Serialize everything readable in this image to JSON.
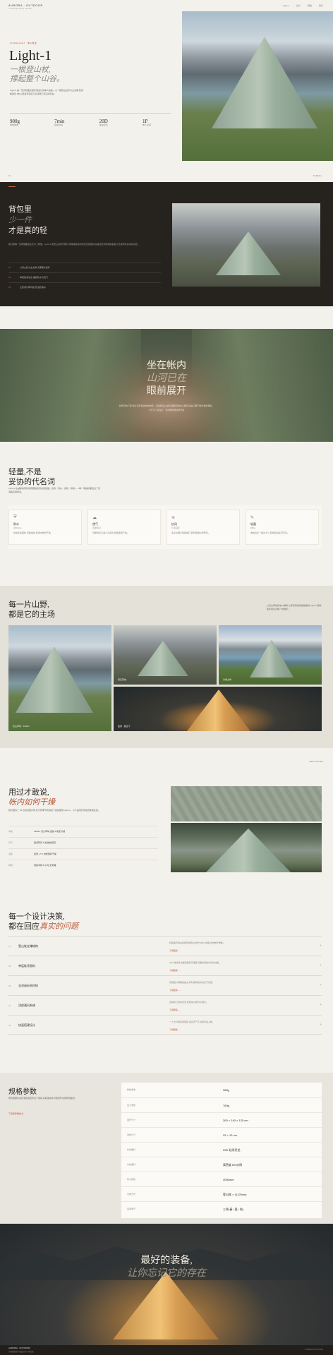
{
  "nav": {
    "logo": "AURORA · OUTDOOR",
    "logo_sub": "LIGHTWEIGHT GEAR",
    "links": [
      "Light-1",
      "设计",
      "规格",
      "联系"
    ]
  },
  "hero": {
    "kicker": "ULTRALIGHT · 单人帐篷",
    "title": "Light-1",
    "sub1": "一根登山杖,",
    "sub2": "撑起整个山谷。",
    "desc": "Light-1 是一顶为轻量化徒步者设计的单人帐篷。以一根登山杖作为主支撑,整顶帐篷仅 980g,装进背包后几乎感觉不到它的存在。",
    "stats": [
      {
        "num": "980g",
        "label": "整帐重量"
      },
      {
        "num": "7min",
        "label": "搭建时间"
      },
      {
        "num": "20D",
        "label": "硅涂尼龙"
      },
      {
        "num": "1P",
        "label": "单人空间"
      }
    ],
    "foot_left": "01",
    "foot_right": "SCROLL ↓"
  },
  "dark": {
    "line1": "背包里",
    "line2": "少一件",
    "line3": "才是真的轻",
    "desc": "我们把每一克重量都放在天平上称量。Light-1 用登山杖替代帐杆,用单层硅涂布替代双层结构,在保证防风防雨的前提下去掉所有多余的东西。",
    "features": [
      {
        "num": "01",
        "text": "以登山杖为主支撑,无需额外帐杆"
      },
      {
        "num": "02",
        "text": "单层硅涂尼龙,兼顾防水与透气"
      },
      {
        "num": "03",
        "text": "全封闭纱网内帐,防虫防露水"
      }
    ]
  },
  "banner": {
    "line1": "坐在帐内",
    "line2": "山河已在",
    "line3": "眼前展开",
    "desc": "拉开双向门帘,整片风景就是你的前院。清晨醒来,山峰与湖面同时映入眼帘,这是只属于徒步者的奢侈。",
    "desc2": "大开口门帘设计 · 支持单侧或双侧开启"
  },
  "weight": {
    "title1": "轻量,不是",
    "title2": "妥协的代名词",
    "desc": "Light-1 在减重的同时没有牺牲任何关键性能。抗风、防水、通风、耐用——每一项指标都经过了高海拔实地测试。",
    "cards": [
      {
        "icon": "shield-icon",
        "glyph": "⛨",
        "title": "防水",
        "sub": "3000mm",
        "desc": "硅涂尼龙面料,压胶缝线,暴雨中依然干爽。"
      },
      {
        "icon": "cloud-icon",
        "glyph": "☁",
        "title": "透气",
        "sub": "双通风口",
        "desc": "顶部通风口减少冷凝水,整夜保持干燥。"
      },
      {
        "icon": "wind-icon",
        "glyph": "≋",
        "title": "抗风",
        "sub": "8 点固定",
        "desc": "多点拉绳与加强地钉,稳稳抵御山脊阵风。"
      },
      {
        "icon": "feather-icon",
        "glyph": "✎",
        "title": "轻量",
        "sub": "980g",
        "desc": "收纳后仅一瓶水大小,轻松装进任何背包。"
      }
    ]
  },
  "gallery": {
    "title1": "每一片山野,",
    "title2": "都是它的主场",
    "desc": "从高山草甸到冰川湖畔,从碎石营地到夜色森林,Light-1 陪伴徒步者走过每一种地形。",
    "captions": [
      "高山草甸 · 3200m",
      "碎石营地",
      "冰湖之畔",
      "夜营 · 星空下"
    ]
  },
  "story": {
    "label": "FIELD NOTES",
    "title1": "用过才敢说,",
    "title2": "帐内如何干燥",
    "desc": "我们邀请了 30 位资深徒步者,在不同季节和海拔下连续使用 Light-1。以下是他们真实的使用反馈。",
    "rows": [
      {
        "k": "海拔",
        "v": "3200m 高山草甸,连续 5 晚无冷凝"
      },
      {
        "k": "天气",
        "v": "夜间阵风 6 级,帐体稳定"
      },
      {
        "k": "温度",
        "v": "最低 -2°C,内帐保持干燥"
      },
      {
        "k": "降雨",
        "v": "持续中雨 8 小时,无渗漏"
      }
    ]
  },
  "design": {
    "title1": "每一个设计决策,",
    "title2": "都在回应",
    "title3": "真实的问题",
    "rows": [
      {
        "num": "01",
        "title": "登山杖支撑结构",
        "desc": "利用徒步者本就携带的登山杖作为中心支撑,省去帐杆重量。",
        "link": "了解更多 →"
      },
      {
        "num": "02",
        "title": "单层硅涂面料",
        "desc": "20D 硅涂尼龙兼顾强度与轻量,双面涂层提升防水性能。",
        "link": "了解更多 →"
      },
      {
        "num": "03",
        "title": "全封闭纱网内帐",
        "desc": "高密度纱网隔绝蚊虫,同时保持良好的空气流通。",
        "link": "了解更多 →"
      },
      {
        "num": "04",
        "title": "顶部通风系统",
        "desc": "双通风口形成对流,有效减少帐内冷凝水。",
        "link": "了解更多 →"
      },
      {
        "num": "05",
        "title": "快速搭建设计",
        "desc": "一人七分钟完成搭建,恶劣天气下也能迅速入帐。",
        "link": "了解更多 →"
      }
    ]
  },
  "specs": {
    "title": "规格参数",
    "desc": "所有数据均在标准实验室环境下测得,实际使用中可能因环境而有所差异。",
    "link": "下载完整规格书 →",
    "rows": [
      {
        "k": "整帐重量",
        "v": "980g"
      },
      {
        "k": "最小重量",
        "v": "760g"
      },
      {
        "k": "展开尺寸",
        "v": "260 × 140 × 125 cm"
      },
      {
        "k": "收纳尺寸",
        "v": "32 × 12 cm"
      },
      {
        "k": "外帐面料",
        "v": "20D 硅涂尼龙"
      },
      {
        "k": "内帐面料",
        "v": "高密度 B3 纱网"
      },
      {
        "k": "防水指数",
        "v": "3000mm"
      },
      {
        "k": "支撑方式",
        "v": "登山杖 × 1(125cm)"
      },
      {
        "k": "适用季节",
        "v": "三季(春 / 夏 / 秋)"
      }
    ]
  },
  "closing": {
    "line1": "最好的装备,",
    "line2": "让你忘记它的存在"
  },
  "footer": {
    "logo": "AURORA · OUTDOOR",
    "desc": "为轻量化徒步者设计的户外装备。",
    "copy": "© AURORA OUTDOOR"
  }
}
